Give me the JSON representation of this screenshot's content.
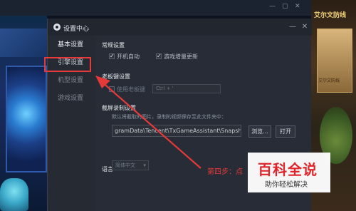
{
  "dialog": {
    "title": "设置中心",
    "minimize_icon": "minimize-icon",
    "close_icon": "close-icon"
  },
  "sidebar": {
    "items": [
      {
        "label": "基本设置"
      },
      {
        "label": "引擎设置"
      },
      {
        "label": "机型设置"
      },
      {
        "label": "游戏设置"
      }
    ]
  },
  "general": {
    "title": "常规设置",
    "autostart_label": "开机自动",
    "autostart_checked": true,
    "update_label": "游戏增量更新",
    "update_checked": true
  },
  "boss_key": {
    "title": "老板键设置",
    "enable_label": "使用老板键",
    "enable_checked": false,
    "shortcut_value": "Ctrl + '"
  },
  "screenshot": {
    "title": "截屏录制设置",
    "description": "默认将截取的图片，录制的视频保存至此文件夹中：",
    "path_value": "gramData\\Tencent\\TxGameAssistant\\Snapshot",
    "browse_label": "浏览...",
    "open_label": "打开"
  },
  "language": {
    "title": "语言",
    "selected": "简体中文"
  },
  "annotation": {
    "step_text": "第四步：点",
    "color": "#e5393a"
  },
  "watermark": {
    "main": "百科全说",
    "sub": "助你轻松解决"
  },
  "background": {
    "right_title": "艾尔文防线",
    "panel_text": "艾尔文防线"
  }
}
